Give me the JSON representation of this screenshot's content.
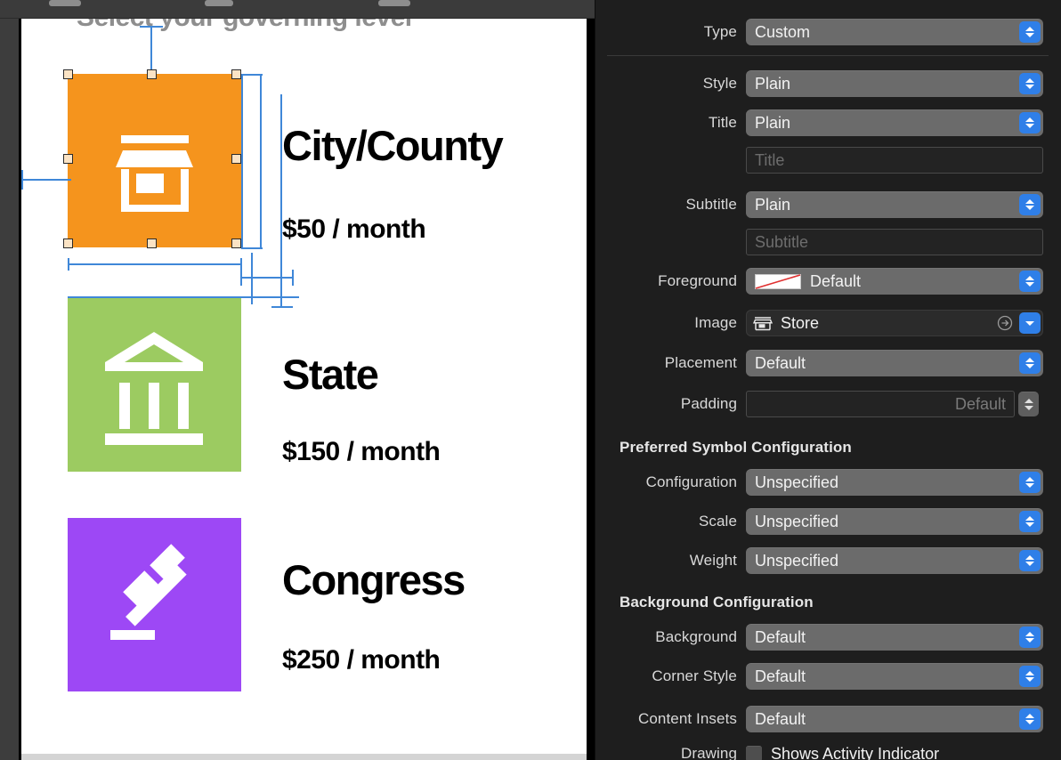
{
  "window": {
    "app": "Xcode Interface Builder",
    "toolbar_tabs": [
      "",
      "",
      ""
    ]
  },
  "canvas": {
    "headline": "Select your governing level",
    "rows": [
      {
        "id": "city-county",
        "title": "City/County",
        "price": "$50 / month",
        "tile_color": "#F5941D",
        "icon": "store-icon",
        "selected": true
      },
      {
        "id": "state",
        "title": "State",
        "price": "$150 / month",
        "tile_color": "#9CCB61",
        "icon": "bank-icon",
        "selected": false
      },
      {
        "id": "congress",
        "title": "Congress",
        "price": "$250 / month",
        "tile_color": "#9D48F5",
        "icon": "gavel-icon",
        "selected": false
      }
    ],
    "selection_color": "#3F87D8",
    "handle_color": "#FBE3C4"
  },
  "inspector": {
    "accent_color": "#2F7FE8",
    "rows": [
      {
        "label": "Type",
        "control": "popup",
        "value": "Custom"
      },
      {
        "label": "Style",
        "control": "popup",
        "value": "Plain"
      },
      {
        "label": "Title",
        "control": "popup",
        "value": "Plain"
      },
      {
        "label": "",
        "control": "textfield",
        "value": "",
        "placeholder": "Title"
      },
      {
        "label": "Subtitle",
        "control": "popup",
        "value": "Plain"
      },
      {
        "label": "",
        "control": "textfield",
        "value": "",
        "placeholder": "Subtitle"
      },
      {
        "label": "Foreground",
        "control": "color",
        "value": "Default"
      },
      {
        "label": "Image",
        "control": "image",
        "value": "Store",
        "icon": "store-symbol-icon"
      },
      {
        "label": "Placement",
        "control": "popup",
        "value": "Default"
      },
      {
        "label": "Padding",
        "control": "stepper",
        "value": "",
        "placeholder": "Default"
      }
    ],
    "sections": [
      {
        "header": "Preferred Symbol Configuration",
        "rows": [
          {
            "label": "Configuration",
            "control": "popup",
            "value": "Unspecified"
          },
          {
            "label": "Scale",
            "control": "popup",
            "value": "Unspecified"
          },
          {
            "label": "Weight",
            "control": "popup",
            "value": "Unspecified"
          }
        ]
      },
      {
        "header": "Background Configuration",
        "rows": [
          {
            "label": "Background",
            "control": "popup",
            "value": "Default"
          },
          {
            "label": "Corner Style",
            "control": "popup",
            "value": "Default"
          },
          {
            "label": "Content Insets",
            "control": "popup",
            "value": "Default"
          }
        ]
      }
    ],
    "drawing": {
      "label": "Drawing",
      "checkbox_label": "Shows Activity Indicator",
      "checked": false
    }
  }
}
